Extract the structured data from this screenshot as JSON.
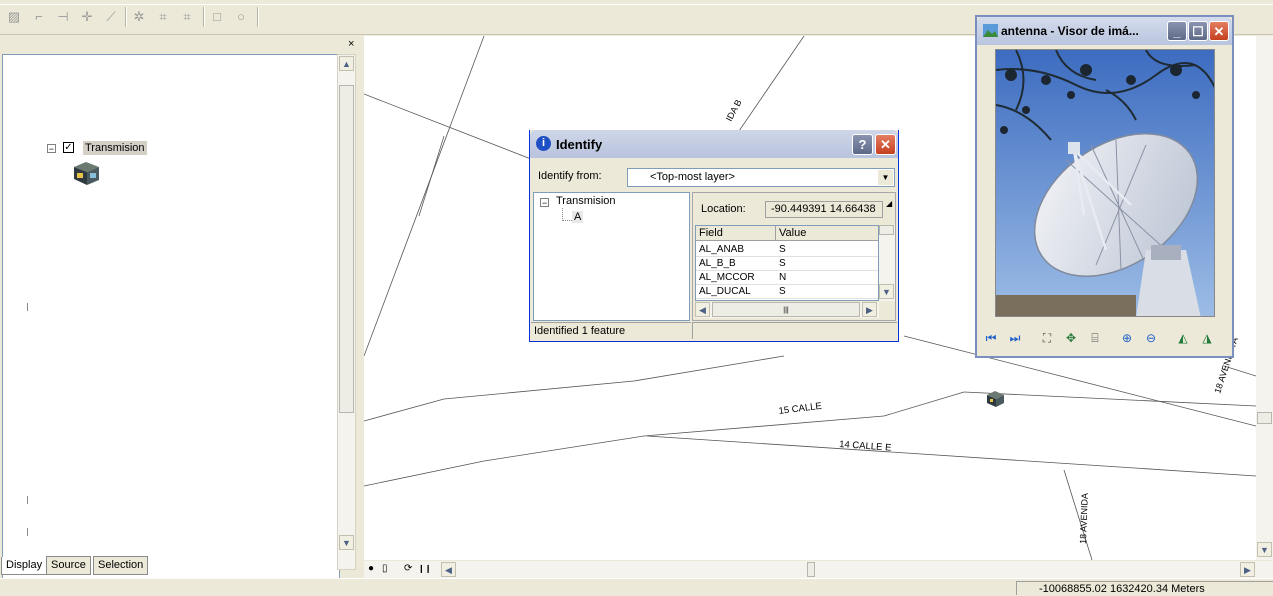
{
  "toolbar": {
    "icons": [
      "edit-vertices-icon",
      "reshape-icon",
      "cut-icon",
      "split-icon",
      "trace-icon",
      "rotate-icon",
      "topology-icon",
      "topology-edit-icon",
      "rectangle-icon",
      "circle-icon"
    ]
  },
  "toc": {
    "close_glyph": "×",
    "layer": {
      "name": "Transmision",
      "checked": true,
      "toggle": "−"
    },
    "tabs": [
      "Display",
      "Source",
      "Selection"
    ],
    "active_tab": "Display"
  },
  "map": {
    "labels": [
      "IDA B",
      "15 CALLE",
      "14 CALLE E",
      "18 AVENIDA",
      "18 AVENIDA A"
    ],
    "tools": [
      "●",
      "▯",
      "⟳",
      "❙❙"
    ]
  },
  "statusbar": {
    "coordinates": "-10068855.02  1632420.34 Meters"
  },
  "identify": {
    "title": "Identify",
    "help_glyph": "?",
    "close_glyph": "✕",
    "identify_from_label": "Identify from:",
    "identify_from_value": "<Top-most layer>",
    "tree": {
      "layer": "Transmision",
      "feature": "A"
    },
    "location_label": "Location:",
    "location_value": "-90.449391  14.66438",
    "table": {
      "headers": [
        "Field",
        "Value"
      ],
      "rows": [
        {
          "field": "AL_ANAB",
          "value": "S"
        },
        {
          "field": "AL_B_B",
          "value": "S"
        },
        {
          "field": "AL_MCCOR",
          "value": "N"
        },
        {
          "field": "AL_DUCAL",
          "value": "S"
        }
      ]
    },
    "status": "Identified 1 feature"
  },
  "viewer": {
    "title": "antenna - Visor de imá...",
    "minimize_glyph": "_",
    "maximize_glyph": "☐",
    "close_glyph": "✕",
    "tools": [
      "previous-icon",
      "next-icon",
      "zoom-extent-icon",
      "pan-icon",
      "fit-icon",
      "zoom-in-icon",
      "zoom-out-icon",
      "rotate-left-icon",
      "rotate-right-icon"
    ]
  }
}
